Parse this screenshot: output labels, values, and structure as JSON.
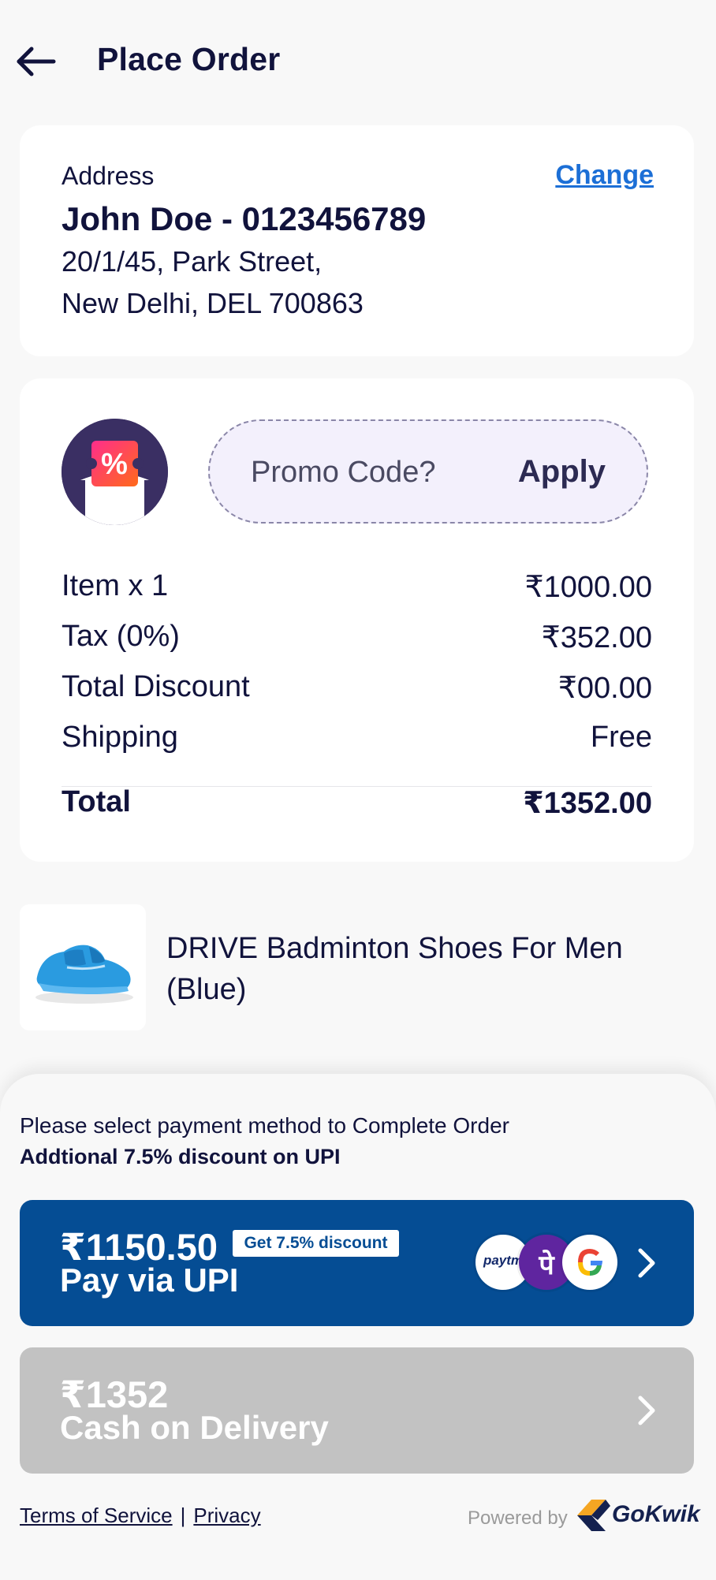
{
  "header": {
    "title": "Place Order",
    "back_icon": "arrow-left-icon"
  },
  "address": {
    "label": "Address",
    "change_label": "Change",
    "name_phone": "John Doe - 0123456789",
    "line1": "20/1/45, Park Street,",
    "line2": "New Delhi, DEL 700863"
  },
  "promo": {
    "icon": "discount-coupon-icon",
    "placeholder": "Promo Code?",
    "apply_label": "Apply"
  },
  "summary": {
    "rows": [
      {
        "label": "Item x 1",
        "value": "₹1000.00"
      },
      {
        "label": "Tax (0%)",
        "value": "₹352.00"
      },
      {
        "label": "Total Discount",
        "value": "₹00.00"
      },
      {
        "label": "Shipping",
        "value": "Free"
      }
    ],
    "total": {
      "label": "Total",
      "value": "₹1352.00"
    }
  },
  "product": {
    "name": "DRIVE Badminton Shoes For Men (Blue)",
    "image_icon": "blue-shoe-image"
  },
  "payment": {
    "prompt": "Please select payment method to Complete Order",
    "offer": "Addtional 7.5% discount on UPI",
    "upi": {
      "amount": "₹1150.50",
      "badge": "Get 7.5% discount",
      "label": "Pay via UPI",
      "logos": [
        "paytm-logo",
        "phonepe-logo",
        "google-pay-logo"
      ],
      "paytm_text": "paytm",
      "phonepe_text": "पे",
      "color": "#054d94"
    },
    "cod": {
      "amount": "₹1352",
      "label": "Cash on Delivery",
      "color": "#c2c2c2"
    }
  },
  "footer": {
    "terms": "Terms of Service",
    "separator": "|",
    "privacy": "Privacy",
    "powered_by": "Powered by",
    "brand": "GoKwik"
  },
  "colors": {
    "text": "#11133c",
    "link": "#1c6fd6",
    "background": "#f8f8f8"
  }
}
